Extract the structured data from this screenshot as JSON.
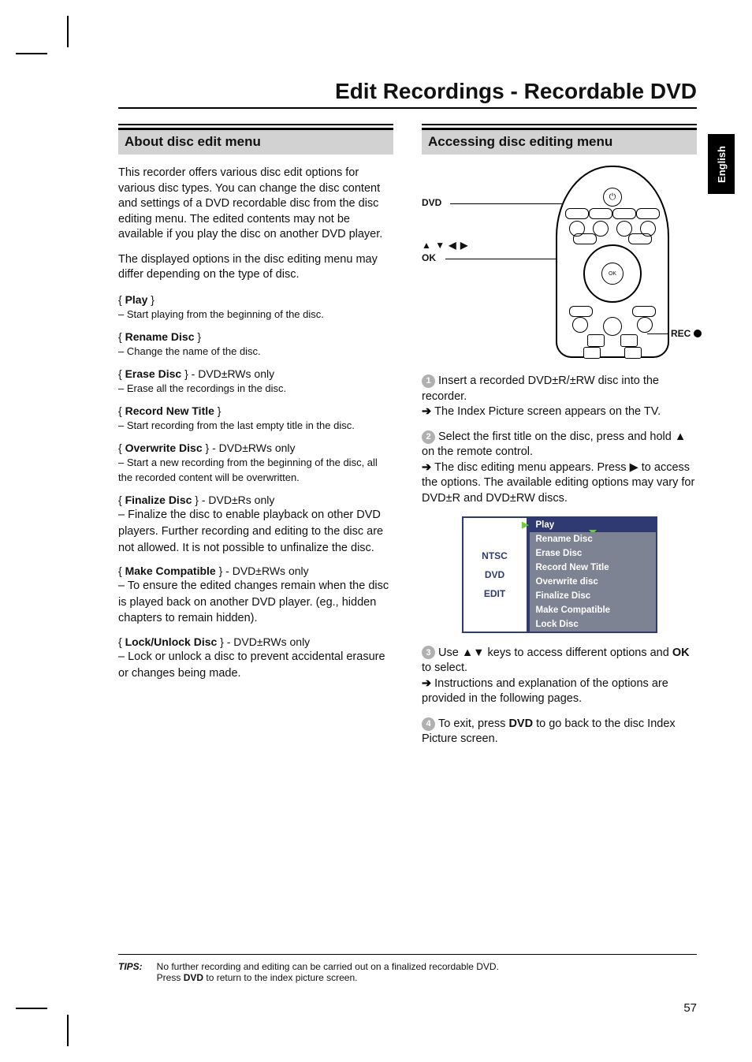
{
  "title": "Edit Recordings - Recordable DVD",
  "language_tab": "English",
  "left": {
    "heading": "About disc edit menu",
    "intro1": "This recorder offers various disc edit options for various disc types. You can change the disc content and settings of a DVD recordable disc from the disc editing menu. The edited contents may not be available if you play the disc on another DVD player.",
    "intro2": "The displayed options in the disc editing menu may differ depending on the type of disc.",
    "options": [
      {
        "name": "Play",
        "suffix": "",
        "desc": "– Start playing from the beginning of the disc."
      },
      {
        "name": "Rename Disc",
        "suffix": "",
        "desc": "– Change the name of the disc."
      },
      {
        "name": "Erase Disc",
        "suffix": " - DVD±RWs only",
        "desc": "– Erase all the recordings in the disc."
      },
      {
        "name": "Record New Title",
        "suffix": "",
        "desc": "– Start recording from the last empty title in the disc."
      },
      {
        "name": "Overwrite Disc",
        "suffix": " - DVD±RWs only",
        "desc": "– Start a new recording from the beginning of the disc, all the recorded content will be overwritten."
      },
      {
        "name": "Finalize Disc",
        "suffix": " - DVD±Rs only",
        "desc": "– Finalize the disc to enable playback on other DVD players. Further recording and editing to the disc are not allowed. It is not possible to unfinalize the disc."
      },
      {
        "name": "Make Compatible",
        "suffix": " - DVD±RWs only",
        "desc": "– To ensure the edited changes remain when the disc is played back on another DVD player. (eg., hidden chapters to remain hidden)."
      },
      {
        "name": "Lock/Unlock Disc",
        "suffix": " - DVD±RWs only",
        "desc": "– Lock or unlock a disc to prevent accidental erasure or changes being made."
      }
    ]
  },
  "right": {
    "heading": "Accessing disc editing menu",
    "labels": {
      "dvd": "DVD",
      "arrows_ok": "▲ ▼ ◀ ▶",
      "ok": "OK",
      "rec": "REC",
      "nav_center": "OK"
    },
    "step1a": "Insert a recorded DVD±R/±RW disc into the recorder.",
    "step1b": "The Index Picture screen appears on the TV.",
    "step2a": "Select the first title on the disc, press and hold ▲ on the remote control.",
    "step2b": "The disc editing menu appears. Press ▶ to access the options. The available editing options may vary for DVD±R and DVD±RW discs.",
    "menu_left": {
      "line1": "NTSC",
      "line2": "DVD",
      "line3": "EDIT"
    },
    "menu_rows": [
      {
        "label": "Play",
        "selected": true
      },
      {
        "label": "Rename Disc",
        "selected": false
      },
      {
        "label": "Erase Disc",
        "selected": false
      },
      {
        "label": "Record New Title",
        "selected": false
      },
      {
        "label": "Overwrite disc",
        "selected": false
      },
      {
        "label": "Finalize Disc",
        "selected": false
      },
      {
        "label": "Make Compatible",
        "selected": false
      },
      {
        "label": "Lock Disc",
        "selected": false
      }
    ],
    "step3a": "Use ▲▼ keys to access different options and ",
    "step3b_ok": "OK",
    "step3c": " to select.",
    "step3d": "Instructions and explanation of the options are provided in the following pages.",
    "step4a": "To exit, press ",
    "step4b_dvd": "DVD",
    "step4c": " to go back to the disc Index Picture screen."
  },
  "tips": {
    "label": "TIPS:",
    "line1": "No further recording and editing can be carried out on a finalized recordable DVD.",
    "line2_a": "Press ",
    "line2_b": "DVD",
    "line2_c": " to return to the index picture screen."
  },
  "page_number": "57"
}
